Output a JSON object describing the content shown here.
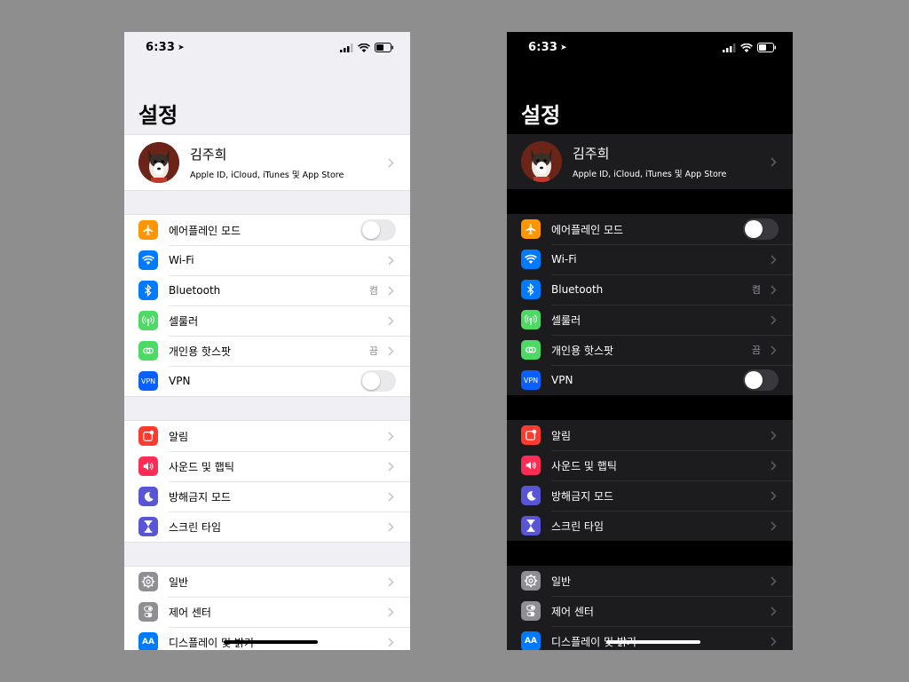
{
  "status": {
    "time": "6:33"
  },
  "title": "설정",
  "profile": {
    "name": "김주희",
    "subtitle": "Apple ID, iCloud, iTunes 및 App Store"
  },
  "network": {
    "airplane": {
      "label": "에어플레인 모드",
      "on": false,
      "icon": "airplane-icon",
      "color": "#ff9500"
    },
    "wifi": {
      "label": "Wi-Fi",
      "icon": "wifi-icon",
      "color": "#007aff"
    },
    "bluetooth": {
      "label": "Bluetooth",
      "value": "켬",
      "icon": "bluetooth-icon",
      "color": "#007aff"
    },
    "cellular": {
      "label": "셀룰러",
      "icon": "cellular-antenna-icon",
      "color": "#4cd964"
    },
    "hotspot": {
      "label": "개인용 핫스팟",
      "value": "끔",
      "icon": "hotspot-icon",
      "color": "#4cd964"
    },
    "vpn": {
      "label": "VPN",
      "icon_text": "VPN",
      "on": false,
      "color": "#0a60ff"
    }
  },
  "notifications": {
    "alerts": {
      "label": "알림",
      "icon": "notifications-icon",
      "color": "#ff3b30"
    },
    "sounds": {
      "label": "사운드 및 햅틱",
      "icon": "speaker-icon",
      "color": "#ff2d55"
    },
    "dnd": {
      "label": "방해금지 모드",
      "icon": "moon-icon",
      "color": "#5856d6"
    },
    "screentime": {
      "label": "스크린 타임",
      "icon": "hourglass-icon",
      "color": "#5856d6"
    }
  },
  "general_group": {
    "general": {
      "label": "일반",
      "icon": "gear-icon",
      "color": "#8e8e93"
    },
    "control": {
      "label": "제어 센터",
      "icon": "toggles-icon",
      "color": "#8e8e93"
    },
    "display": {
      "label": "디스플레이 및 밝기",
      "icon_text": "AA",
      "color": "#007aff"
    }
  }
}
